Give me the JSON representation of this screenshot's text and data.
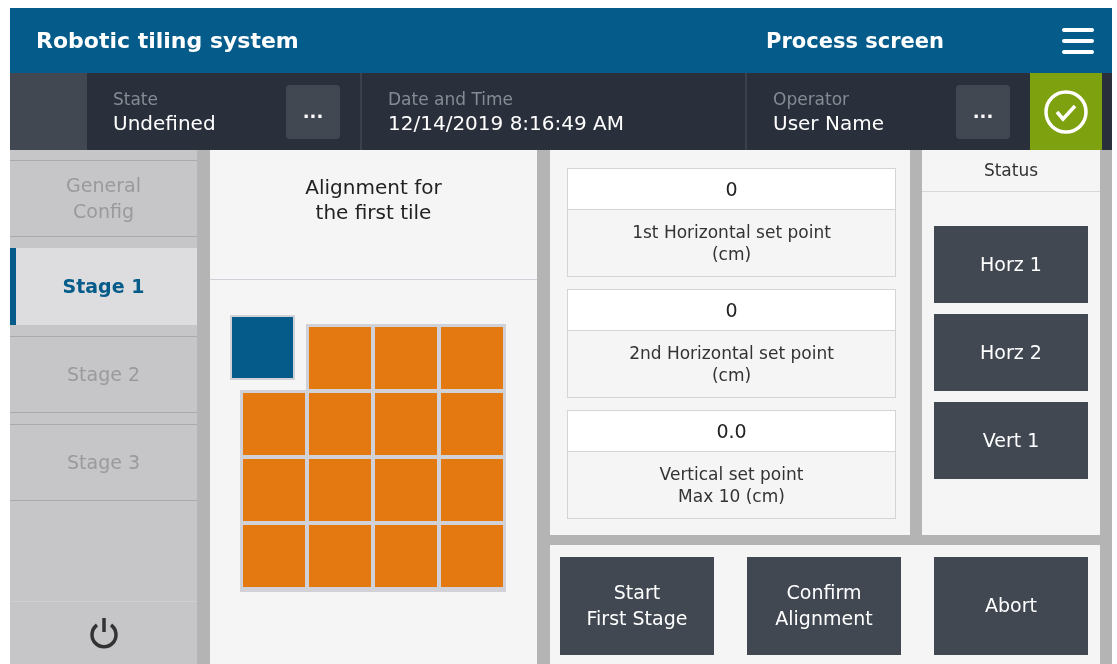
{
  "header": {
    "title": "Robotic tiling system",
    "screen_title": "Process screen"
  },
  "info_bar": {
    "fields": [
      {
        "label": "State",
        "value": "Undefined",
        "more_button": "..."
      },
      {
        "label": "Date and Time",
        "value": "12/14/2019 8:16:49 AM"
      },
      {
        "label": "Operator",
        "value": "User Name",
        "more_button": "..."
      }
    ],
    "status_ok": true
  },
  "sidebar": {
    "items": [
      {
        "label": "General\nConfig",
        "selected": false
      },
      {
        "label": "Stage 1",
        "selected": true
      },
      {
        "label": "Stage 2",
        "selected": false
      },
      {
        "label": "Stage 3",
        "selected": false
      }
    ]
  },
  "alignment": {
    "title": "Alignment for\nthe first tile"
  },
  "setpoints": [
    {
      "value": "0",
      "label": "1st Horizontal set point\n(cm)"
    },
    {
      "value": "0",
      "label": "2nd Horizontal set point\n(cm)"
    },
    {
      "value": "0.0",
      "label": "Vertical set point\nMax 10 (cm)"
    }
  ],
  "status": {
    "title": "Status",
    "buttons": [
      "Horz 1",
      "Horz 2",
      "Vert 1"
    ]
  },
  "actions": [
    "Start\nFirst Stage",
    "Confirm\nAlignment",
    "Abort"
  ]
}
